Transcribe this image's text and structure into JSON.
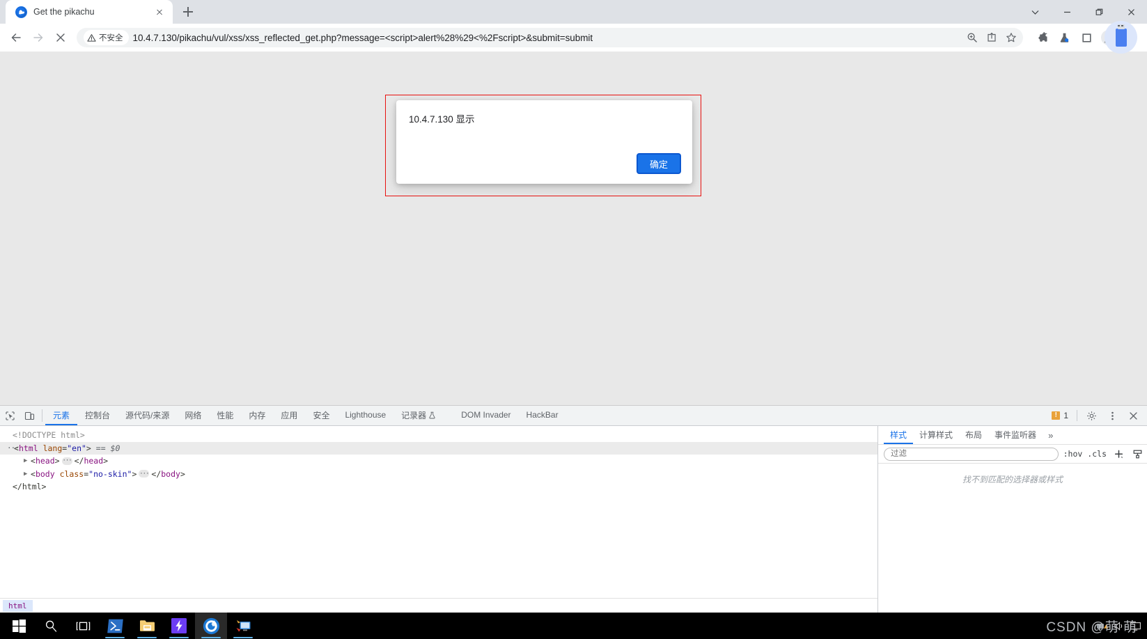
{
  "browser": {
    "tab": {
      "title": "Get the pikachu",
      "favicon": "pikachu-favicon",
      "close_icon": "close-icon"
    },
    "new_tab_label": "+",
    "window_controls": [
      "chevron-down-icon",
      "minimize-icon",
      "maximize-icon",
      "close-icon"
    ],
    "nav": {
      "back": "back-arrow-icon",
      "forward": "forward-arrow-icon",
      "stop": "stop-x-icon"
    },
    "omnibox": {
      "security_label": "不安全",
      "security_icon": "warning-triangle-icon",
      "url": "10.4.7.130/pikachu/vul/xss/xss_reflected_get.php?message=<script>alert%28%29<%2Fscript>&submit=submit",
      "right_icons": [
        "zoom-icon",
        "share-icon",
        "bookmark-star-icon"
      ]
    },
    "extensions": [
      "puzzle-extensions-icon",
      "flask-lab-icon",
      "square-panel-icon",
      "profile-avatar-icon",
      "kebab-menu-icon"
    ]
  },
  "dialog": {
    "origin": "10.4.7.130 显示",
    "message": "",
    "ok_label": "确定",
    "highlight_color": "#e8110f",
    "accent_color": "#1a73e8"
  },
  "devtools": {
    "left_icons": [
      "inspect-element-icon",
      "device-toolbar-icon"
    ],
    "tabs": [
      {
        "label": "元素",
        "active": true
      },
      {
        "label": "控制台",
        "active": false
      },
      {
        "label": "源代码/来源",
        "active": false
      },
      {
        "label": "网络",
        "active": false
      },
      {
        "label": "性能",
        "active": false
      },
      {
        "label": "内存",
        "active": false
      },
      {
        "label": "应用",
        "active": false
      },
      {
        "label": "安全",
        "active": false
      },
      {
        "label": "Lighthouse",
        "active": false
      },
      {
        "label": "记录器",
        "active": false
      },
      {
        "label": "DOM Invader",
        "active": false
      },
      {
        "label": "HackBar",
        "active": false
      }
    ],
    "recorder_badge": "flask-icon",
    "warning_count": "1",
    "right_icons": [
      "warning-badge",
      "settings-gear-icon",
      "more-kebab-icon",
      "close-devtools-icon"
    ],
    "dom": {
      "doctype": "<!DOCTYPE html>",
      "html_open_tag": "html",
      "html_attr_name": "lang",
      "html_attr_value": "\"en\"",
      "selected_marker": "== $0",
      "head_tag": "head",
      "body_tag": "body",
      "body_attr_name": "class",
      "body_attr_value": "\"no-skin\"",
      "html_close": "</html>",
      "collapsed_glyph": "···"
    },
    "breadcrumb": [
      "html"
    ],
    "styles": {
      "tabs": [
        {
          "label": "样式",
          "active": true
        },
        {
          "label": "计算样式",
          "active": false
        },
        {
          "label": "布局",
          "active": false
        },
        {
          "label": "事件监听器",
          "active": false
        }
      ],
      "more_label": "»",
      "filter_placeholder": "过滤",
      "filter_value": "",
      "hov_label": ":hov",
      "cls_label": ".cls",
      "new_rule_icon": "plus-icon",
      "print_icon": "paintbrush-icon",
      "empty_message": "找不到匹配的选择器或样式"
    }
  },
  "taskbar": {
    "items": [
      {
        "name": "start-button",
        "icon": "windows-logo-icon"
      },
      {
        "name": "search-button",
        "icon": "search-icon"
      },
      {
        "name": "task-view-button",
        "icon": "task-view-icon"
      },
      {
        "name": "powershell-app",
        "icon": "powershell-icon"
      },
      {
        "name": "file-explorer-app",
        "icon": "folder-icon"
      },
      {
        "name": "lightning-app",
        "icon": "lightning-bolt-icon"
      },
      {
        "name": "chromium-app",
        "icon": "chromium-icon"
      },
      {
        "name": "remote-desktop-app",
        "icon": "remote-desktop-icon"
      }
    ],
    "watermark": "CSDN @萌 萌"
  }
}
